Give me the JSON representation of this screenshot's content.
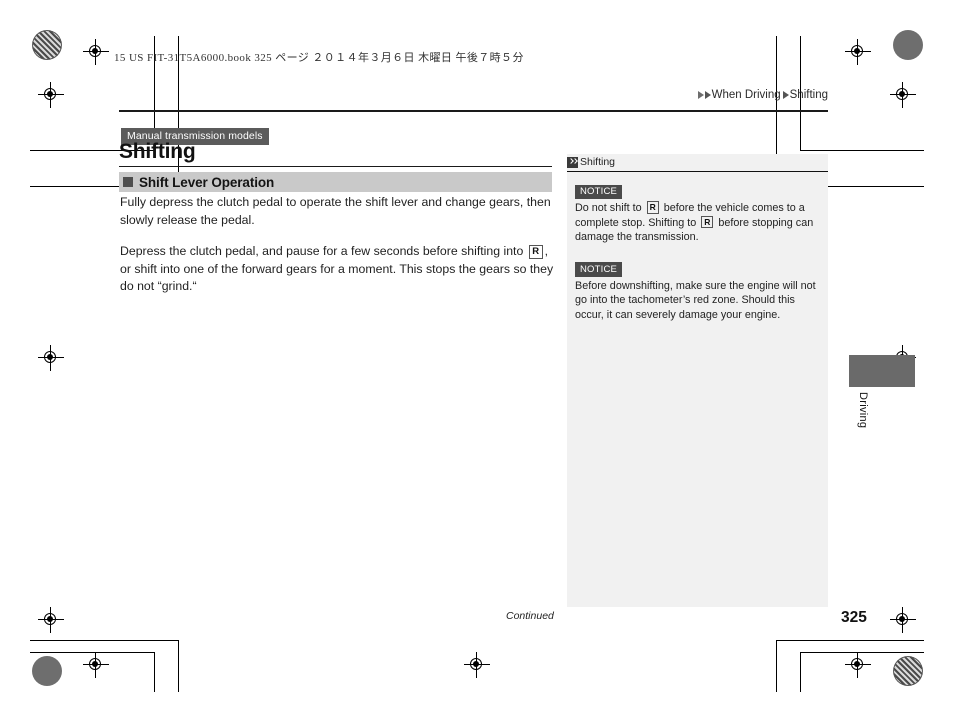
{
  "document": {
    "book_slug": "15 US FIT-31T5A6000.book   325 ページ   ２０１４年３月６日   木曜日   午後７時５分",
    "page_number": "325",
    "continued_label": "Continued"
  },
  "breadcrumb": {
    "section": "When Driving",
    "topic": "Shifting"
  },
  "title_block": {
    "badge": "Manual transmission models",
    "title": "Shifting"
  },
  "section": {
    "heading": "Shift Lever Operation"
  },
  "body": {
    "paragraph1": "Fully depress the clutch pedal to operate the shift lever and change gears, then slowly release the pedal.",
    "paragraph2_part1": "Depress the clutch pedal, and pause for a few seconds before shifting into",
    "paragraph2_gear": "R",
    "paragraph2_part2": ", or shift into one of the forward gears for a moment. This stops the gears so they do not “grind.“"
  },
  "sidebar": {
    "header": "Shifting",
    "notices": [
      {
        "tag": "NOTICE",
        "text_part1": "Do not shift to",
        "gear1": "R",
        "text_part2": "before the vehicle comes to a complete stop. Shifting to",
        "gear2": "R",
        "text_part3": "before stopping can damage the transmission."
      },
      {
        "tag": "NOTICE",
        "text": "Before downshifting, make sure the engine will not go into the tachometer’s red zone. Should this occur, it can severely damage your engine."
      }
    ]
  },
  "edge_tab": {
    "label": "Driving"
  },
  "colors": {
    "badge_bg": "#5b5b5b",
    "section_bar_bg": "#c9c9c9",
    "sidebar_bg": "#f1f1f1",
    "notice_tag_bg": "#4a4a4a",
    "edge_tab_bg": "#6a6a6a"
  }
}
